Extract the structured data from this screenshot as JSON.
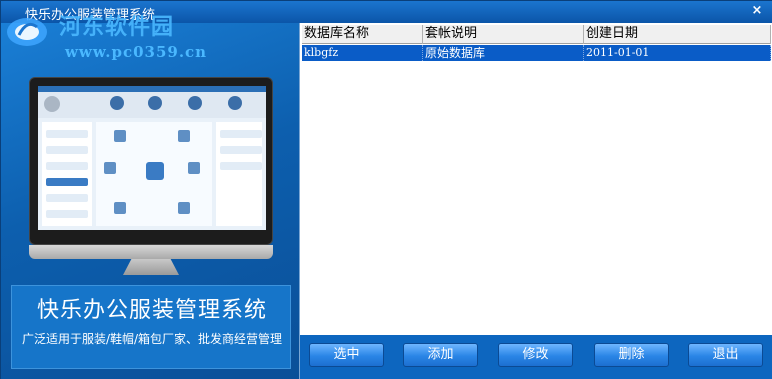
{
  "window": {
    "title": "快乐办公服装管理系统",
    "close_glyph": "×",
    "watermark_line1": "河东软件园",
    "watermark_line2": "www.pc0359.cn"
  },
  "promo": {
    "title": "快乐办公服装管理系统",
    "subtitle": "广泛适用于服装/鞋帽/箱包厂家、批发商经营管理"
  },
  "table": {
    "columns": [
      "数据库名称",
      "套帐说明",
      "创建日期"
    ],
    "rows": [
      [
        "klbgfz",
        "原始数据库",
        "2011-01-01"
      ]
    ],
    "selected_row": 0
  },
  "buttons": {
    "select": "选中",
    "add": "添加",
    "edit": "修改",
    "delete": "删除",
    "exit": "退出"
  },
  "colors": {
    "title_bar": "#0b55a8",
    "selection": "#0a5cc7",
    "button": "#2a85e6"
  }
}
